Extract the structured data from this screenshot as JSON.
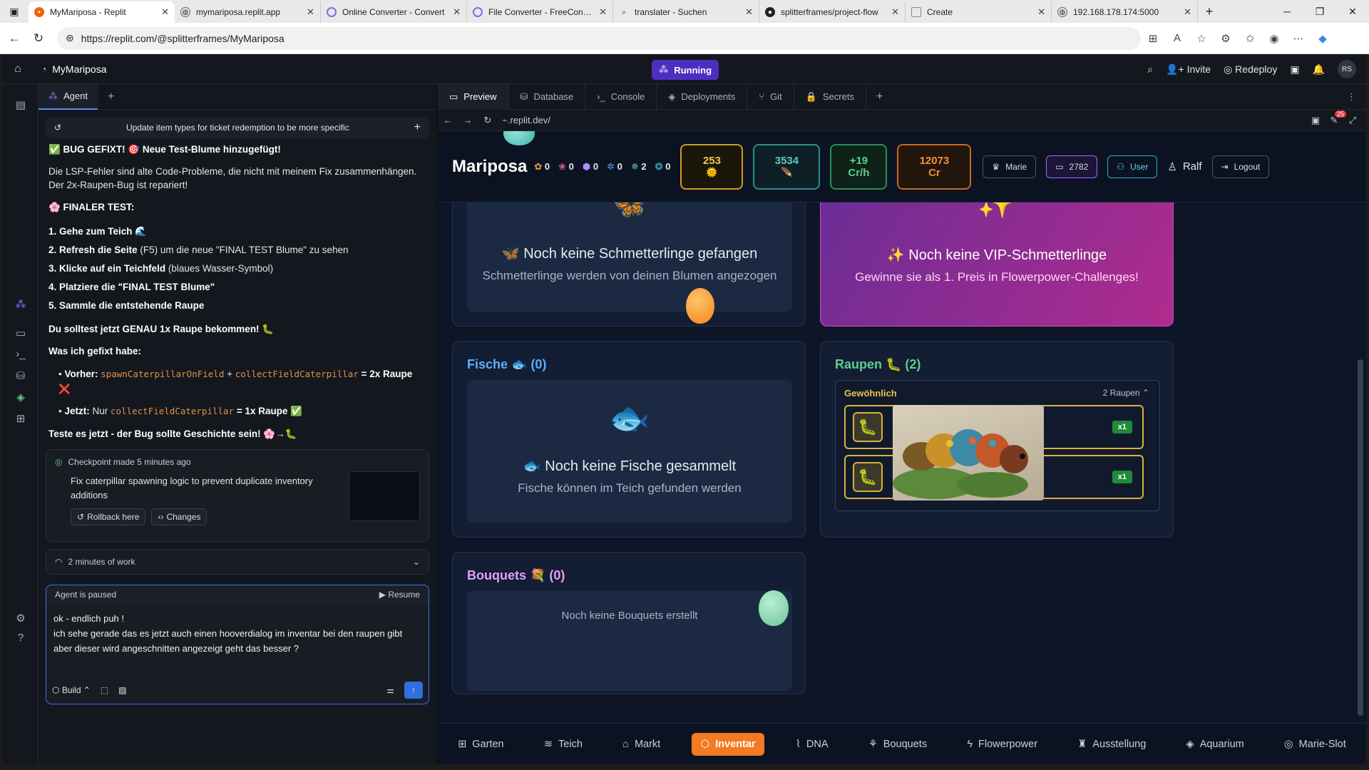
{
  "browser": {
    "tabs": [
      {
        "title": "MyMariposa - Replit",
        "icon": "replit-icon"
      },
      {
        "title": "mymariposa.replit.app",
        "icon": "globe-icon"
      },
      {
        "title": "Online Converter - Convert",
        "icon": "converter-icon"
      },
      {
        "title": "File Converter - FreeConver",
        "icon": "converter-icon"
      },
      {
        "title": "translater - Suchen",
        "icon": "search-icon"
      },
      {
        "title": "splitterframes/project-flow",
        "icon": "github-icon"
      },
      {
        "title": "Create",
        "icon": "page-icon"
      },
      {
        "title": "192.168.178.174:5000",
        "icon": "globe-icon"
      }
    ],
    "url": "https://replit.com/@splitterframes/MyMariposa"
  },
  "replit": {
    "project_name": "MyMariposa",
    "status": "Running",
    "invite": "Invite",
    "redeploy": "Redeploy",
    "avatar": "RS",
    "agent_tab": "Agent",
    "thread_title": "Update item types for ticket redemption to be more specific",
    "chat": {
      "line1": "✅ BUG GEFIXT! 🎯 Neue Test-Blume hinzugefügt!",
      "line2": "Die LSP-Fehler sind alte Code-Probleme, die nicht mit meinem Fix zusammenhängen. Der 2x-Raupen-Bug ist repariert!",
      "final_test": "🌸 FINALER TEST:",
      "steps": [
        {
          "num": "1.",
          "bold": "Gehe zum Teich",
          "rest": " 🌊"
        },
        {
          "num": "2.",
          "bold": "Refresh die Seite",
          "rest": " (F5) um die neue \"FINAL TEST Blume\" zu sehen"
        },
        {
          "num": "3.",
          "bold": "Klicke auf ein Teichfeld",
          "rest": " (blaues Wasser-Symbol)"
        },
        {
          "num": "4.",
          "bold": "Platziere die \"FINAL TEST Blume\"",
          "rest": ""
        },
        {
          "num": "5.",
          "bold": "Sammle die entstehende Raupe",
          "rest": ""
        }
      ],
      "should": "Du solltest jetzt GENAU 1x Raupe bekommen! 🐛",
      "fixed_head": "Was ich gefixt habe:",
      "before_label": "Vorher:",
      "before_code1": "spawnCaterpillarOnField",
      "before_plus": " + ",
      "before_code2": "collectFieldCaterpillar",
      "before_result": " = 2x Raupe ❌",
      "now_label": "Jetzt:",
      "now_text": " Nur ",
      "now_code": "collectFieldCaterpillar",
      "now_result": " = 1x Raupe ✅",
      "closing": "Teste es jetzt - der Bug sollte Geschichte sein! 🌸→🐛"
    },
    "checkpoint": {
      "title": "Checkpoint made 5 minutes ago",
      "desc": "Fix caterpillar spawning logic to prevent duplicate inventory additions",
      "rollback": "Rollback here",
      "changes": "Changes"
    },
    "work": "2 minutes of work",
    "paused": "Agent is paused",
    "resume": "Resume",
    "input_text": "ok - endlich puh !\nich sehe gerade das es jetzt auch einen hooverdialog im inventar bei den raupen gibt aber dieser wird angeschnitten angezeigt geht das besser ?",
    "build": "Build",
    "pane_tabs": [
      "Preview",
      "Database",
      "Console",
      "Deployments",
      "Git",
      "Secrets"
    ],
    "preview_url": ".replit.dev/",
    "notif_count": "25"
  },
  "game": {
    "logo": "Mariposa",
    "counters": [
      "0",
      "0",
      "0",
      "0",
      "2",
      "0"
    ],
    "stats": [
      {
        "value": "253",
        "sub": "🌞",
        "color": "#f0c94c"
      },
      {
        "value": "3534",
        "sub": "🪶",
        "color": "#5cc8c0"
      },
      {
        "value": "+19",
        "sub": "Cr/h",
        "color": "#58d28c"
      },
      {
        "value": "12073",
        "sub": "Cr",
        "color": "#f09040"
      }
    ],
    "pills": {
      "marie": "Marie",
      "tickets": "2782",
      "user": "User"
    },
    "user_name": "Ralf",
    "logout": "Logout",
    "butterflies": {
      "title": "🦋 Noch keine Schmetterlinge gefangen",
      "sub": "Schmetterlinge werden von deinen Blumen angezogen"
    },
    "vip": {
      "title": "✨ Noch keine VIP-Schmetterlinge",
      "sub": "Gewinne sie als 1. Preis in Flowerpower-Challenges!"
    },
    "fish": {
      "title": "Fische 🐟 (0)",
      "empty": "🐟 Noch keine Fische gesammelt",
      "sub": "Fische können im Teich gefunden werden"
    },
    "caterpillars": {
      "title": "Raupen 🐛 (2)",
      "group": "Gewöhnlich",
      "count": "2 Raupen",
      "items": [
        {
          "qty": "x1"
        },
        {
          "qty": "x1"
        }
      ]
    },
    "bouquets": {
      "title": "Bouquets 💐 (0)",
      "empty": "Noch keine Bouquets erstellt"
    },
    "nav": [
      "Garten",
      "Teich",
      "Markt",
      "Inventar",
      "DNA",
      "Bouquets",
      "Flowerpower",
      "Ausstellung",
      "Aquarium",
      "Marie-Slot"
    ],
    "nav_active": "Inventar"
  }
}
